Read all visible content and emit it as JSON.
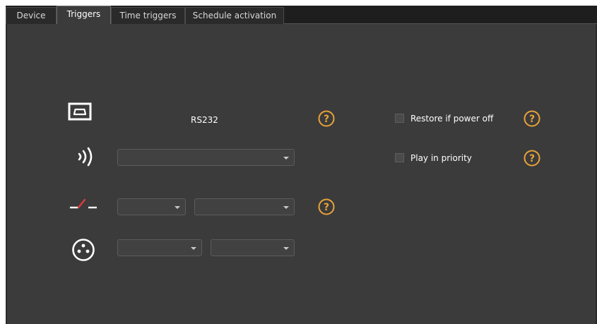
{
  "tabs": [
    {
      "label": "Device",
      "active": false
    },
    {
      "label": "Triggers",
      "active": true
    },
    {
      "label": "Time triggers",
      "active": false
    },
    {
      "label": "Schedule activation",
      "active": false
    }
  ],
  "triggers": {
    "serial": {
      "icon": "serial-port-icon",
      "label": "RS232"
    },
    "ir": {
      "icon": "infrared-icon",
      "dropdown_value": ""
    },
    "contact": {
      "icon": "contact-switch-icon",
      "dropdown1_value": "",
      "dropdown2_value": ""
    },
    "dmx": {
      "icon": "dmx-connector-icon",
      "dropdown1_value": "",
      "dropdown2_value": ""
    }
  },
  "options": {
    "restore_power_off": {
      "label": "Restore if power off",
      "checked": false
    },
    "play_in_priority": {
      "label": "Play in priority",
      "checked": false
    }
  },
  "colors": {
    "accent": "#e8a33a",
    "contact_red": "#e03a3a",
    "panel_bg": "#3b3b3b",
    "tab_bar_bg": "#1e1e1e"
  }
}
